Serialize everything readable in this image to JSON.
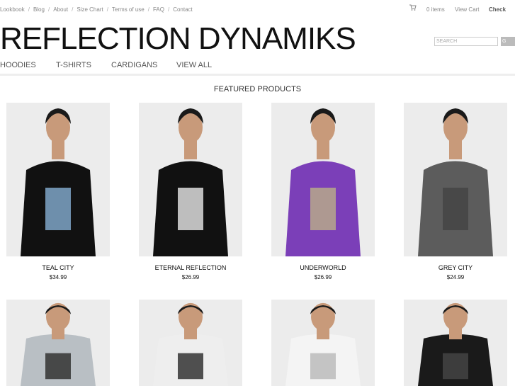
{
  "topnav": {
    "links": [
      "Lookbook",
      "Blog",
      "About",
      "Size Chart",
      "Terms of use",
      "FAQ",
      "Contact"
    ],
    "cart_count": "0 items",
    "view_cart": "View Cart",
    "checkout": "Check"
  },
  "brand": {
    "logo": "REFLECTION DYNAMIKS"
  },
  "search": {
    "placeholder": "SEARCH",
    "button": "G"
  },
  "nav": [
    "HOODIES",
    "T-SHIRTS",
    "CARDIGANS",
    "VIEW ALL"
  ],
  "featured_heading": "FEATURED PRODUCTS",
  "products": [
    {
      "name": "TEAL CITY",
      "price": "$34.99",
      "shirt": "#111111",
      "print": "#7fa6c8"
    },
    {
      "name": "ETERNAL REFLECTION",
      "price": "$26.99",
      "shirt": "#111111",
      "print": "#dddddd"
    },
    {
      "name": "UNDERWORLD",
      "price": "$26.99",
      "shirt": "#7b3fb8",
      "print": "#b7a98a"
    },
    {
      "name": "GREY CITY",
      "price": "$24.99",
      "shirt": "#5c5c5c",
      "print": "#444444"
    },
    {
      "name": "",
      "price": "",
      "shirt": "#b9bfc4",
      "print": "#333333"
    },
    {
      "name": "",
      "price": "",
      "shirt": "#eeeeee",
      "print": "#333333"
    },
    {
      "name": "",
      "price": "",
      "shirt": "#f4f4f4",
      "print": "#bbbbbb"
    },
    {
      "name": "",
      "price": "",
      "shirt": "#1a1a1a",
      "print": "#444444"
    }
  ],
  "colors": {
    "accent": "#888888",
    "text": "#111111"
  }
}
